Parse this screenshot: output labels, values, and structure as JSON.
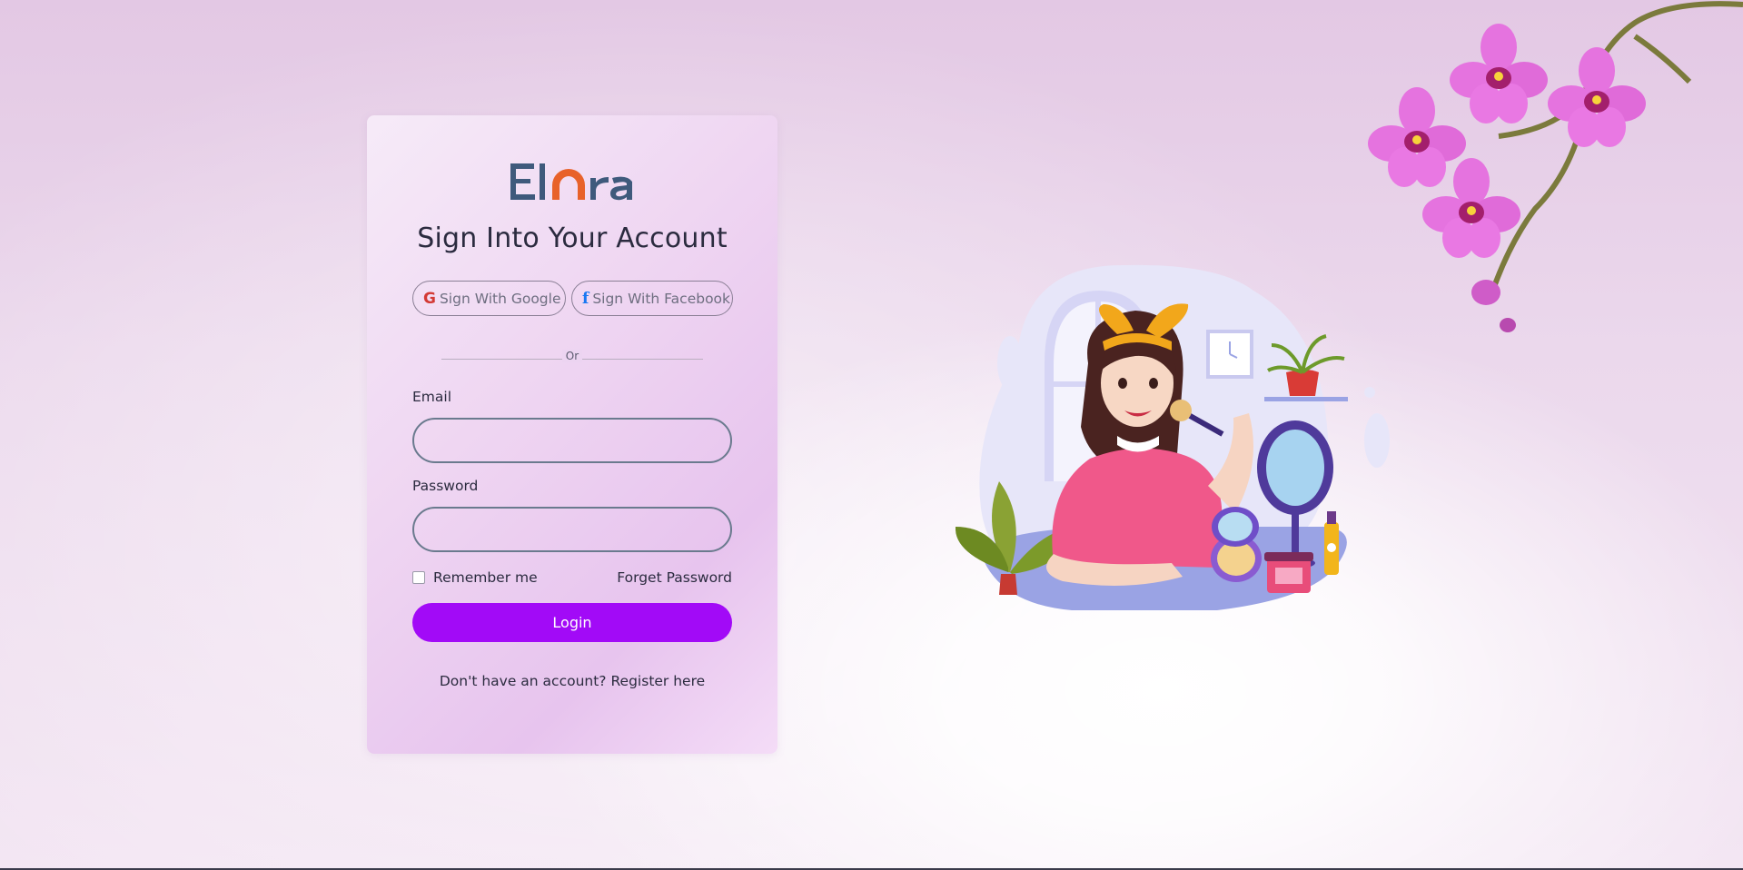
{
  "brand": {
    "logo_text": "Elora",
    "colors": {
      "logo_blue": "#3f5a7c",
      "logo_orange": "#e8622a",
      "accent": "#a20af7"
    }
  },
  "login_card": {
    "title": "Sign Into Your Account",
    "social": {
      "google_icon": "G",
      "google_label": "Sign With Google",
      "facebook_icon": "f",
      "facebook_label": "Sign With Facebook"
    },
    "divider_text": "Or",
    "email": {
      "label": "Email",
      "value": "",
      "placeholder": ""
    },
    "password": {
      "label": "Password",
      "value": "",
      "placeholder": ""
    },
    "remember_me": {
      "label": "Remember me",
      "checked": false
    },
    "forgot_password": "Forget Password",
    "login_button": "Login",
    "register": {
      "prompt": "Don't have an account?",
      "link": "Register here"
    }
  },
  "decor": {
    "illustration": "woman-applying-makeup-illustration",
    "flower": "orchid-branch"
  }
}
